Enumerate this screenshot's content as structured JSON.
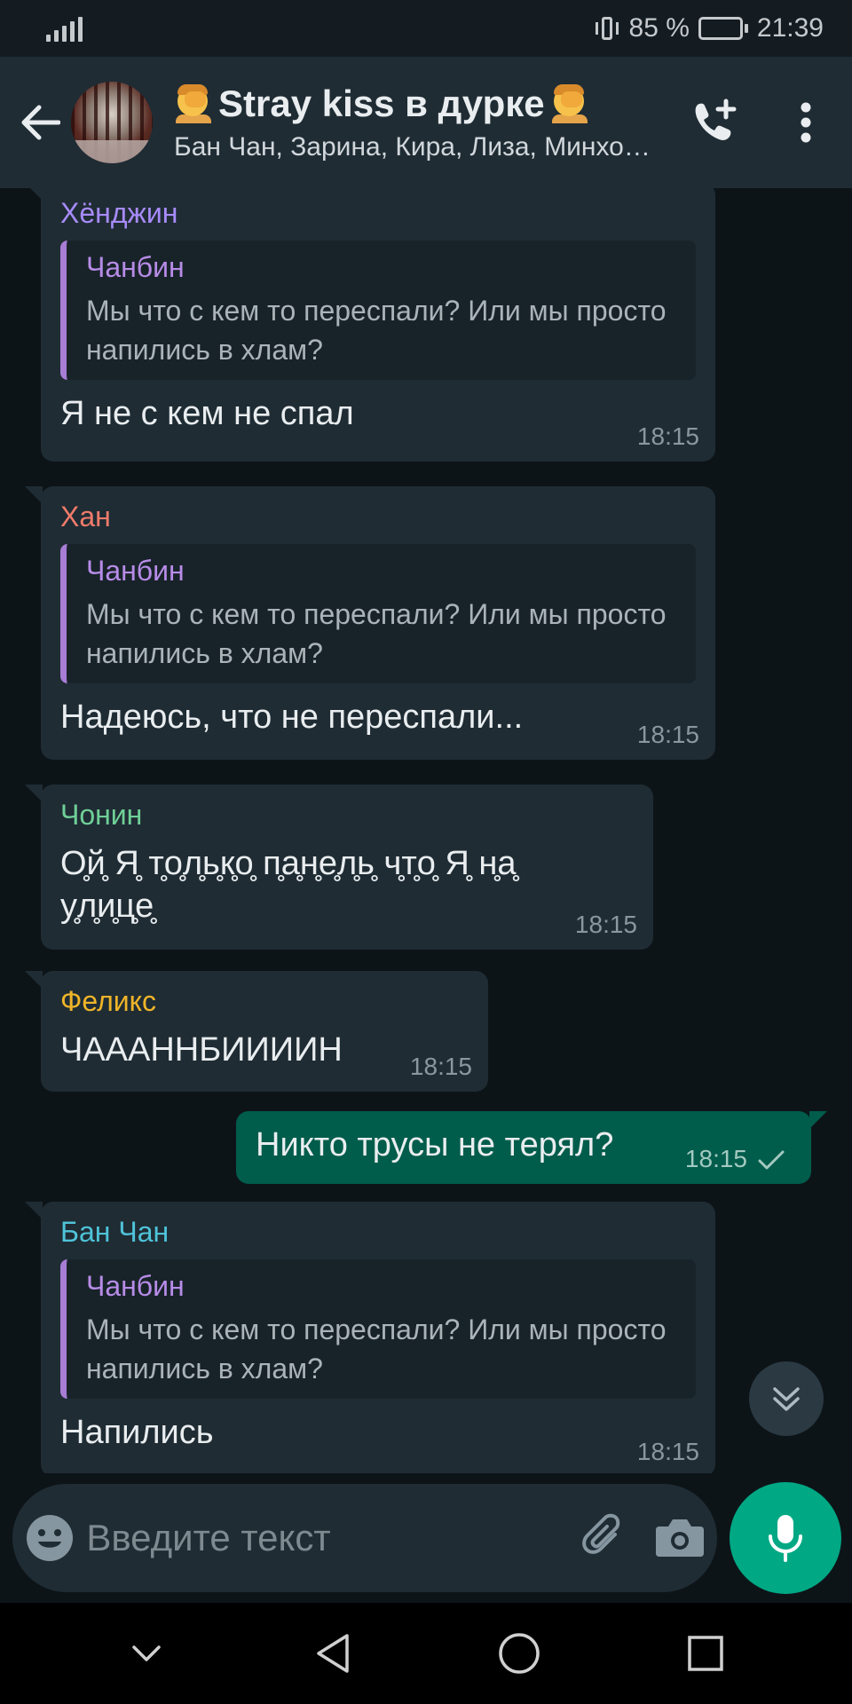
{
  "status_bar": {
    "battery": "85 %",
    "time": "21:39",
    "battery_level": 0.85
  },
  "header": {
    "title": "Stray kiss в дурке",
    "subtitle": "Бан Чан, Зарина, Кира, Лиза, Минхо, Сынмин, Феликс, Хан, Хёнджин, Чанбин, Чонин, Вы",
    "icons": [
      "back-arrow-icon",
      "avatar",
      "add-call-icon",
      "more-vert-icon"
    ]
  },
  "colors": {
    "incoming_bubble": "#1f2c34",
    "outgoing_bubble": "#005c4b",
    "accent": "#00a884",
    "hyunjin": "#a78bfa",
    "han": "#f07b6a",
    "jeongin": "#6fcf97",
    "felix": "#f0b429",
    "bangchan": "#4fc3d9",
    "changbin_quote": "#b78ce8"
  },
  "messages": [
    {
      "sender": "Хёнджин",
      "quote_author": "Чанбин",
      "quote_text": "Мы что с кем то переспали? Или мы просто напились в хлам?",
      "text": "Я не с кем не спал",
      "time": "18:15"
    },
    {
      "sender": "Хан",
      "quote_author": "Чанбин",
      "quote_text": "Мы что с кем то переспали? Или мы просто напились в хлам?",
      "text": "Надеюсь, что не переспали...",
      "time": "18:15"
    },
    {
      "sender": "Чонин",
      "text": "О̥й̥ Я̥ т̥о̥л̥ь̥к̥о̥ п̥а̥н̥е̥л̥ь̥ ч̥т̥о̥ Я̥ н̥а̥ у̥л̥и̥ц̥е̥",
      "time": "18:15"
    },
    {
      "sender": "Феликс",
      "text": "ЧААAННБИИИИН",
      "time": "18:15"
    },
    {
      "outgoing": true,
      "text": "Никто трусы не терял?",
      "time": "18:15",
      "status": "sent-check-icon"
    },
    {
      "sender": "Бан Чан",
      "quote_author": "Чанбин",
      "quote_text": "Мы что с кем то переспали? Или мы просто напились в хлам?",
      "text": "Напились",
      "time": "18:15"
    }
  ],
  "composer": {
    "placeholder": "Введите текст",
    "icons": [
      "emoji-icon",
      "attach-icon",
      "camera-icon",
      "mic-icon"
    ]
  },
  "navbar": {
    "icons": [
      "hide-nav-icon",
      "back-nav-icon",
      "home-nav-icon",
      "recents-nav-icon"
    ]
  }
}
